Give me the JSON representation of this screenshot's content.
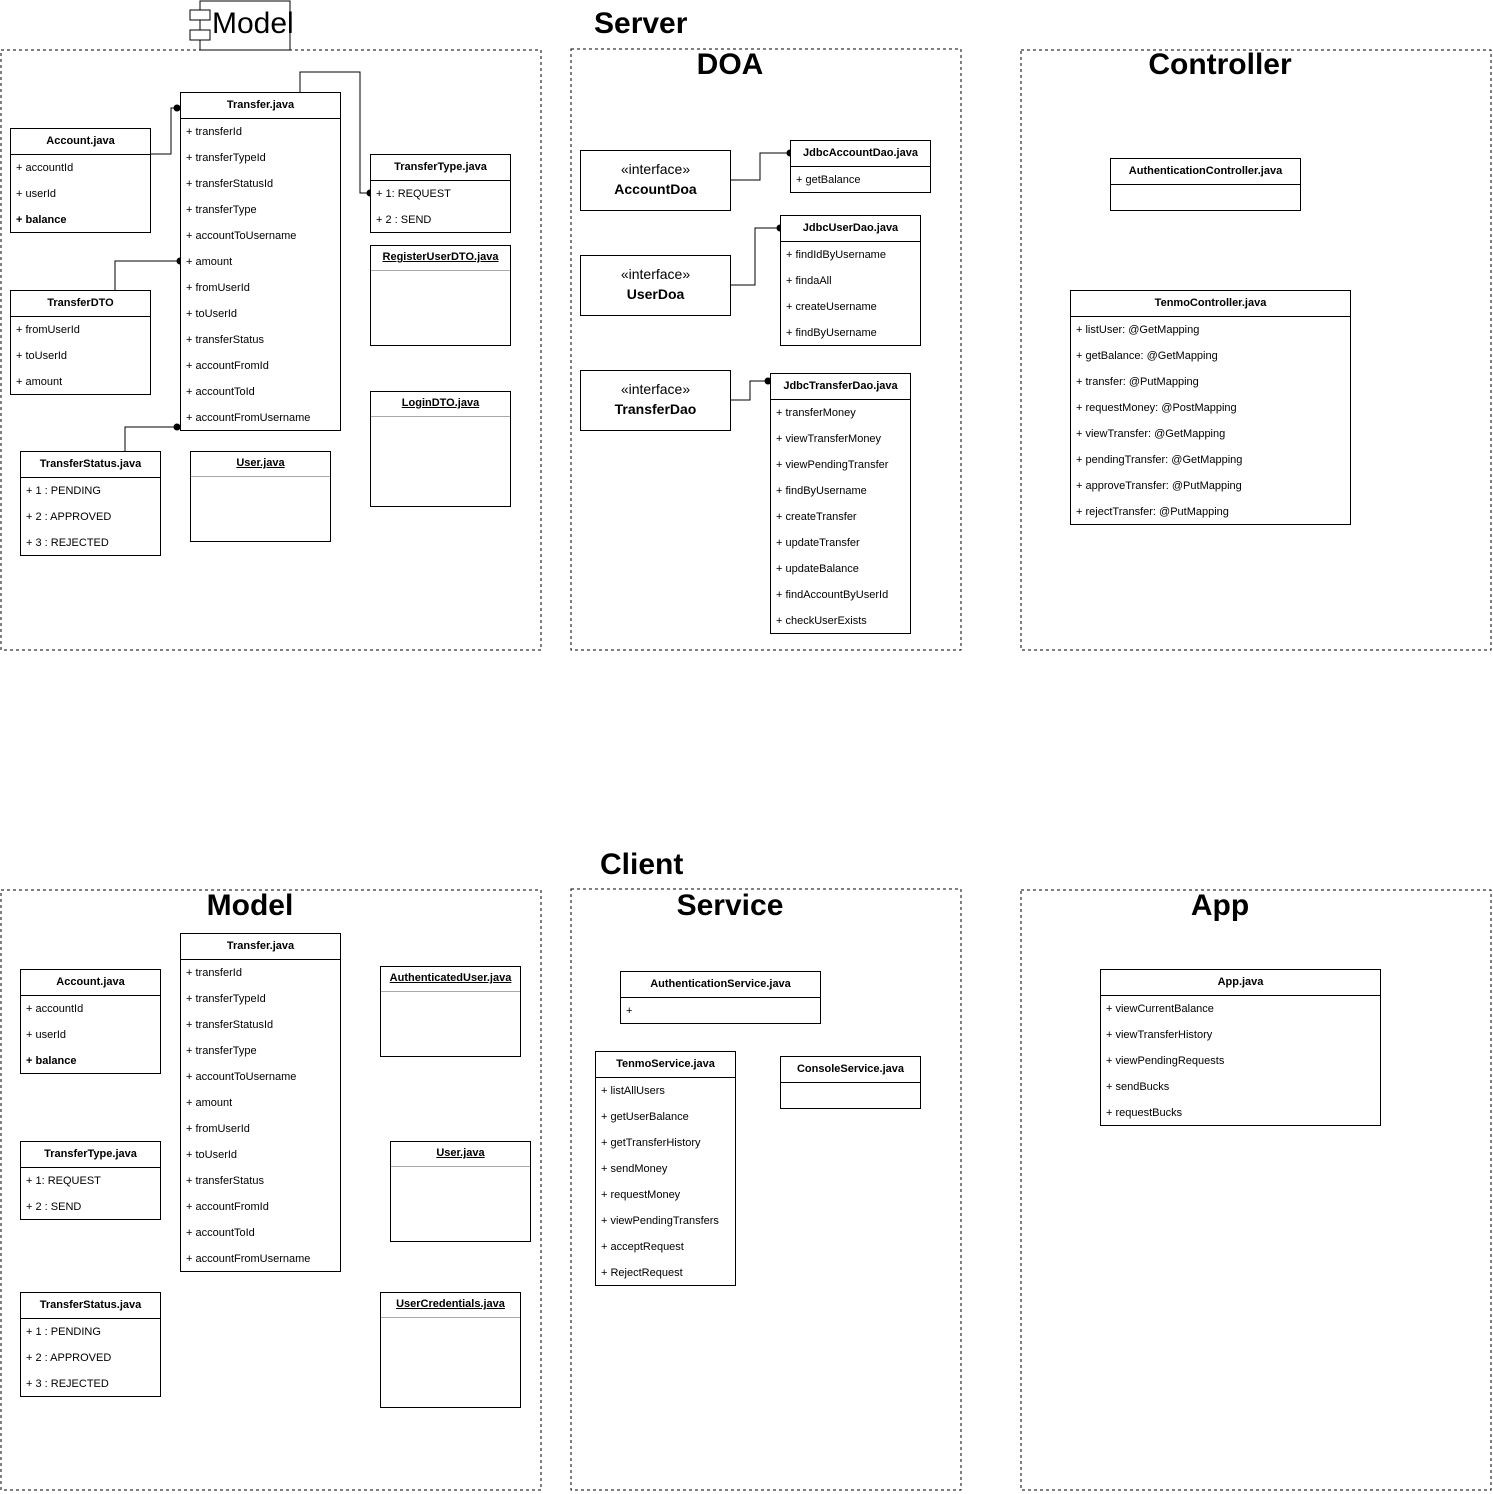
{
  "server": {
    "title": "Server",
    "model": {
      "title": "Model",
      "account": {
        "name": "Account.java",
        "attrs": [
          "+ accountId",
          "+ userId",
          "+ balance"
        ]
      },
      "transfer": {
        "name": "Transfer.java",
        "attrs": [
          "+ transferId",
          "+ transferTypeId",
          "+ transferStatusId",
          "+ transferType",
          "+ accountToUsername",
          "+ amount",
          "+ fromUserId",
          "+ toUserId",
          "+ transferStatus",
          "+ accountFromId",
          "+ accountToId",
          "+ accountFromUsername"
        ]
      },
      "transfer_type": {
        "name": "TransferType.java",
        "attrs": [
          "+ 1: REQUEST",
          "+ 2 : SEND"
        ]
      },
      "register_dto": {
        "name": "RegisterUserDTO.java"
      },
      "transfer_dto": {
        "name": "TransferDTO",
        "attrs": [
          "+ fromUserId",
          "+ toUserId",
          "+ amount"
        ]
      },
      "login_dto": {
        "name": "LoginDTO.java"
      },
      "transfer_status": {
        "name": "TransferStatus.java",
        "attrs": [
          "+ 1 : PENDING",
          "+ 2 : APPROVED",
          "+ 3 : REJECTED"
        ]
      },
      "user": {
        "name": "User.java"
      }
    },
    "doa": {
      "title": "DOA",
      "account_doa": {
        "stereotype": "«interface»",
        "name": "AccountDoa"
      },
      "user_doa": {
        "stereotype": "«interface»",
        "name": "UserDoa"
      },
      "transfer_dao": {
        "stereotype": "«interface»",
        "name": "TransferDao"
      },
      "jdbc_account": {
        "name": "JdbcAccountDao.java",
        "attrs": [
          "+ getBalance"
        ]
      },
      "jdbc_user": {
        "name": "JdbcUserDao.java",
        "attrs": [
          "+ findIdByUsername",
          "+ findaAll",
          "+ createUsername",
          "+ findByUsername"
        ]
      },
      "jdbc_transfer": {
        "name": "JdbcTransferDao.java",
        "attrs": [
          "+ transferMoney",
          "+ viewTransferMoney",
          "+ viewPendingTransfer",
          "+ findByUsername",
          "+ createTransfer",
          "+ updateTransfer",
          "+ updateBalance",
          "+ findAccountByUserId",
          "+ checkUserExists"
        ]
      }
    },
    "controller": {
      "title": "Controller",
      "auth": {
        "name": "AuthenticationController.java"
      },
      "tenmo": {
        "name": "TenmoController.java",
        "attrs": [
          "+ listUser:  @GetMapping",
          "+ getBalance: @GetMapping",
          "+ transfer: @PutMapping",
          "+ requestMoney: @PostMapping",
          "+ viewTransfer: @GetMapping",
          "+ pendingTransfer: @GetMapping",
          "+ approveTransfer: @PutMapping",
          "+ rejectTransfer: @PutMapping"
        ]
      }
    }
  },
  "client": {
    "title": "Client",
    "model": {
      "title": "Model",
      "transfer": {
        "name": "Transfer.java",
        "attrs": [
          "+ transferId",
          "+ transferTypeId",
          "+ transferStatusId",
          "+ transferType",
          "+ accountToUsername",
          "+ amount",
          "+ fromUserId",
          "+ toUserId",
          "+ transferStatus",
          "+ accountFromId",
          "+ accountToId",
          "+ accountFromUsername"
        ]
      },
      "account": {
        "name": "Account.java",
        "attrs": [
          "+ accountId",
          "+ userId",
          "+ balance"
        ]
      },
      "auth_user": {
        "name": "AuthenticatedUser.java"
      },
      "transfer_type": {
        "name": "TransferType.java",
        "attrs": [
          "+ 1: REQUEST",
          "+ 2 : SEND"
        ]
      },
      "user": {
        "name": "User.java"
      },
      "transfer_status": {
        "name": "TransferStatus.java",
        "attrs": [
          "+ 1 : PENDING",
          "+ 2 : APPROVED",
          "+ 3 : REJECTED"
        ]
      },
      "user_credentials": {
        "name": "UserCredentials.java"
      }
    },
    "service": {
      "title": "Service",
      "auth": {
        "name": "AuthenticationService.java",
        "attrs": [
          "+"
        ]
      },
      "tenmo": {
        "name": "TenmoService.java",
        "attrs": [
          "+ listAllUsers",
          "+ getUserBalance",
          "+ getTransferHistory",
          "+ sendMoney",
          "+ requestMoney",
          "+ viewPendingTransfers",
          "+ acceptRequest",
          "+ RejectRequest"
        ]
      },
      "console": {
        "name": "ConsoleService.java"
      }
    },
    "app": {
      "title": "App",
      "app": {
        "name": "App.java",
        "attrs": [
          "+ viewCurrentBalance",
          "+ viewTransferHistory",
          "+ viewPendingRequests",
          "+ sendBucks",
          "+ requestBucks"
        ]
      }
    }
  }
}
